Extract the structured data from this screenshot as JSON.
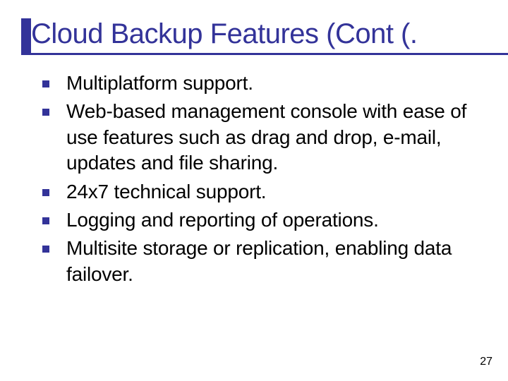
{
  "title": "Cloud Backup Features (Cont (.",
  "bullets": [
    "Multiplatform support.",
    "Web-based management console with ease of use features such as drag and drop, e-mail, updates and file sharing.",
    "24x7 technical support.",
    "Logging and reporting of operations.",
    "Multisite storage or replication, enabling data failover."
  ],
  "page_number": "27"
}
